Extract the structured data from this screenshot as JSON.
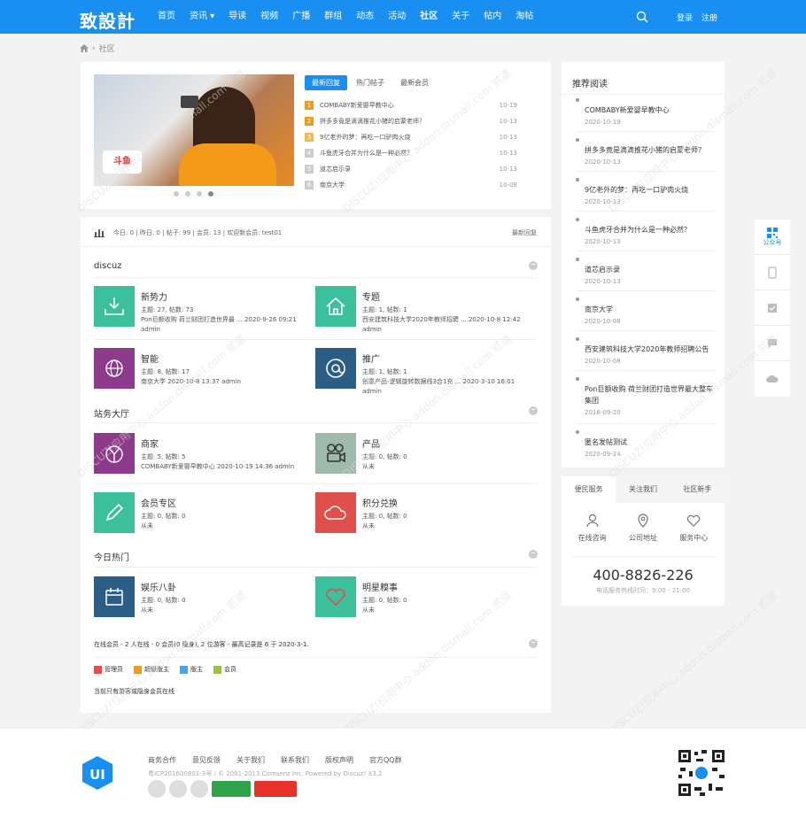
{
  "header": {
    "logo": "致設計",
    "nav": [
      "首页",
      "资讯",
      "导读",
      "视频",
      "广播",
      "群组",
      "动态",
      "活动",
      "社区",
      "关于",
      "帖内",
      "淘帖"
    ],
    "nav_active": "社区",
    "login": "登录",
    "register": "注册"
  },
  "breadcrumb": {
    "current": "社区"
  },
  "slider": {
    "sign_text": "斗鱼"
  },
  "tabs": [
    "最新回复",
    "热门帖子",
    "最新会员"
  ],
  "hot_list": [
    {
      "num": "1",
      "title": "COMBABY新爱婴早教中心",
      "date": "10-19",
      "color": "#f39a1a"
    },
    {
      "num": "2",
      "title": "拼多多竟是滴滴推花小猪的启蒙老师？",
      "date": "10-13",
      "color": "#f39a1a"
    },
    {
      "num": "3",
      "title": "9亿老外的梦：再吃一口驴肉火烧",
      "date": "10-13",
      "color": "#f5b94a"
    },
    {
      "num": "4",
      "title": "斗鱼虎牙合并为什么是一种必然？",
      "date": "10-13",
      "color": "#ccc"
    },
    {
      "num": "5",
      "title": "道芯启示录",
      "date": "10-13",
      "color": "#ccc"
    },
    {
      "num": "6",
      "title": "南京大学",
      "date": "10-08",
      "color": "#ccc"
    }
  ],
  "stats": {
    "text": "今日: 0 | 昨日: 0 | 帖子: 99 | 会员: 13 | 欢迎新会员: test01",
    "latest": "最新回复"
  },
  "sections": [
    {
      "title": "discuz"
    },
    {
      "title": "站务大厅"
    },
    {
      "title": "今日热门"
    }
  ],
  "forums": [
    {
      "name": "新势力",
      "l1": "主题: 27, 帖数: 73",
      "l2": "Pon巨额收购 荷兰财团打造世界最 ... 2020-9-26 09:21",
      "l3": "admin",
      "color": "#3cbf9b"
    },
    {
      "name": "专题",
      "l1": "主题: 1, 帖数: 1",
      "l2": "西安建筑科技大学2020年教师招聘 ... 2020-10-8 12:42",
      "l3": "admin",
      "color": "#3cbf9b"
    },
    {
      "name": "智能",
      "l1": "主题: 8, 帖数: 17",
      "l2": "南京大学 2020-10-8 13:37 admin",
      "l3": "",
      "color": "#8e3a8a"
    },
    {
      "name": "推广",
      "l1": "主题: 1, 帖数: 1",
      "l2": "创意产品-逻辑旋转数据线3合1充 ... 2020-3-10 16:01",
      "l3": "admin",
      "color": "#2b5e86"
    },
    {
      "name": "商家",
      "l1": "主题: 5, 帖数: 5",
      "l2": "COMBABY新爱婴早教中心 2020-10-19 14:36 admin",
      "l3": "",
      "color": "#8e3a8a"
    },
    {
      "name": "产品",
      "l1": "主题: 0, 帖数: 0",
      "l2": "从未",
      "l3": "",
      "color": "#9fb9ab"
    },
    {
      "name": "会员专区",
      "l1": "主题: 0, 帖数: 0",
      "l2": "从未",
      "l3": "",
      "color": "#3cbf9b"
    },
    {
      "name": "积分兑换",
      "l1": "主题: 0, 帖数: 0",
      "l2": "从未",
      "l3": "",
      "color": "#e0504a"
    },
    {
      "name": "娱乐八卦",
      "l1": "主题: 0, 帖数: 0",
      "l2": "从未",
      "l3": "",
      "color": "#2b5e86"
    },
    {
      "name": "明星糗事",
      "l1": "主题: 0, 帖数: 0",
      "l2": "从未",
      "l3": "",
      "color": "#3cbf9b"
    }
  ],
  "online": "在线会员 - 2 人在线 - 0 会员(0 隐身), 2 位游客 - 最高记录是 6 于 2020-3-1.",
  "legend": [
    {
      "label": "管理员",
      "color": "#e0504a"
    },
    {
      "label": "超级版主",
      "color": "#f39a1a"
    },
    {
      "label": "版主",
      "color": "#4aa3e8"
    },
    {
      "label": "会员",
      "color": "#9bc43a"
    }
  ],
  "legend_note": "当前只有游客或隐身会员在线",
  "recommend": {
    "title": "推荐阅读",
    "items": [
      {
        "title": "COMBABY新爱婴早教中心",
        "date": "2020-10-19"
      },
      {
        "title": "拼多多竟是滴滴推花小猪的启蒙老师？",
        "date": "2020-10-13"
      },
      {
        "title": "9亿老外的梦：再吃一口驴肉火烧",
        "date": "2020-10-13"
      },
      {
        "title": "斗鱼虎牙合并为什么是一种必然？",
        "date": "2020-10-13"
      },
      {
        "title": "道芯启示录",
        "date": "2020-10-13"
      },
      {
        "title": "南京大学",
        "date": "2020-10-08"
      },
      {
        "title": "西安建筑科技大学2020年教师招聘公告",
        "date": "2020-10-08"
      },
      {
        "title": "Pon巨额收购 荷兰财团打造世界最大整车集团",
        "date": "2016-09-20"
      },
      {
        "title": "匿名发帖测试",
        "date": "2020-09-24"
      }
    ]
  },
  "service": {
    "tabs": [
      "便民服务",
      "关注我们",
      "社区新手"
    ],
    "items": [
      "在线咨询",
      "公司地址",
      "服务中心"
    ],
    "phone": "400-8826-226",
    "hours": "电话服务热线时间：9:00 - 21:00"
  },
  "sidebar": {
    "qr_label": "公众号"
  },
  "footer": {
    "links": [
      "商务合作",
      "意见反馈",
      "关于我们",
      "联系我们",
      "版权声明",
      "官方QQ群"
    ],
    "copyright": "粤ICP201600801-3号 / © 2001-2013 Comsenz Inc. Powered by Discuz! X3.2",
    "logo_text": "UI"
  },
  "colors": {
    "brand": "#1a8ff2"
  }
}
